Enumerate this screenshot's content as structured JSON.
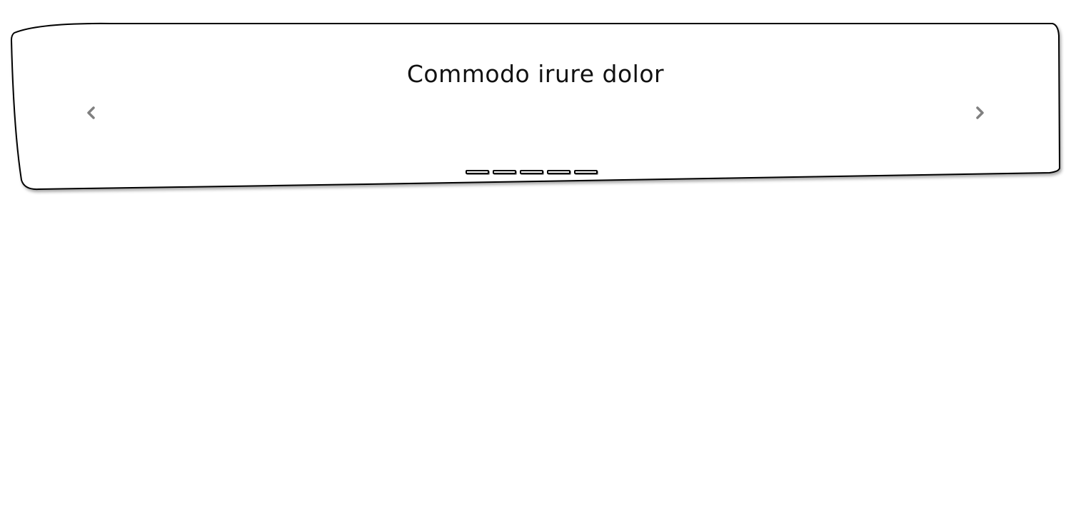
{
  "carousel": {
    "slide_title": "Commodo irure dolor",
    "prev_icon": "chevron-left-icon",
    "next_icon": "chevron-right-icon",
    "indicator_count": 5,
    "active_indicator": 1
  },
  "colors": {
    "background": "#ffffff",
    "border": "#000000",
    "text": "#111111",
    "arrow": "#808080"
  }
}
